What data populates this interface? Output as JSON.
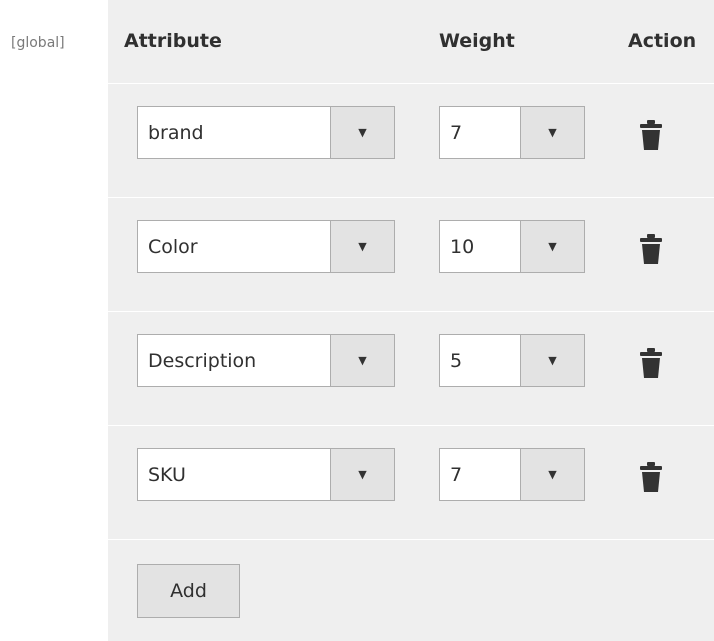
{
  "scope_label": "[global]",
  "table": {
    "headers": {
      "attribute": "Attribute",
      "weight": "Weight",
      "action": "Action"
    },
    "rows": [
      {
        "attribute": "brand",
        "weight": "7"
      },
      {
        "attribute": "Color",
        "weight": "10"
      },
      {
        "attribute": "Description",
        "weight": "5"
      },
      {
        "attribute": "SKU",
        "weight": "7"
      }
    ],
    "dropdown_arrow": "▼",
    "action_icon": "trash-icon",
    "add_label": "Add"
  },
  "colors": {
    "panel_background": "#efefef",
    "select_border": "#adadad",
    "arrow_background": "#e3e3e3",
    "text": "#303030",
    "icon": "#333333"
  }
}
